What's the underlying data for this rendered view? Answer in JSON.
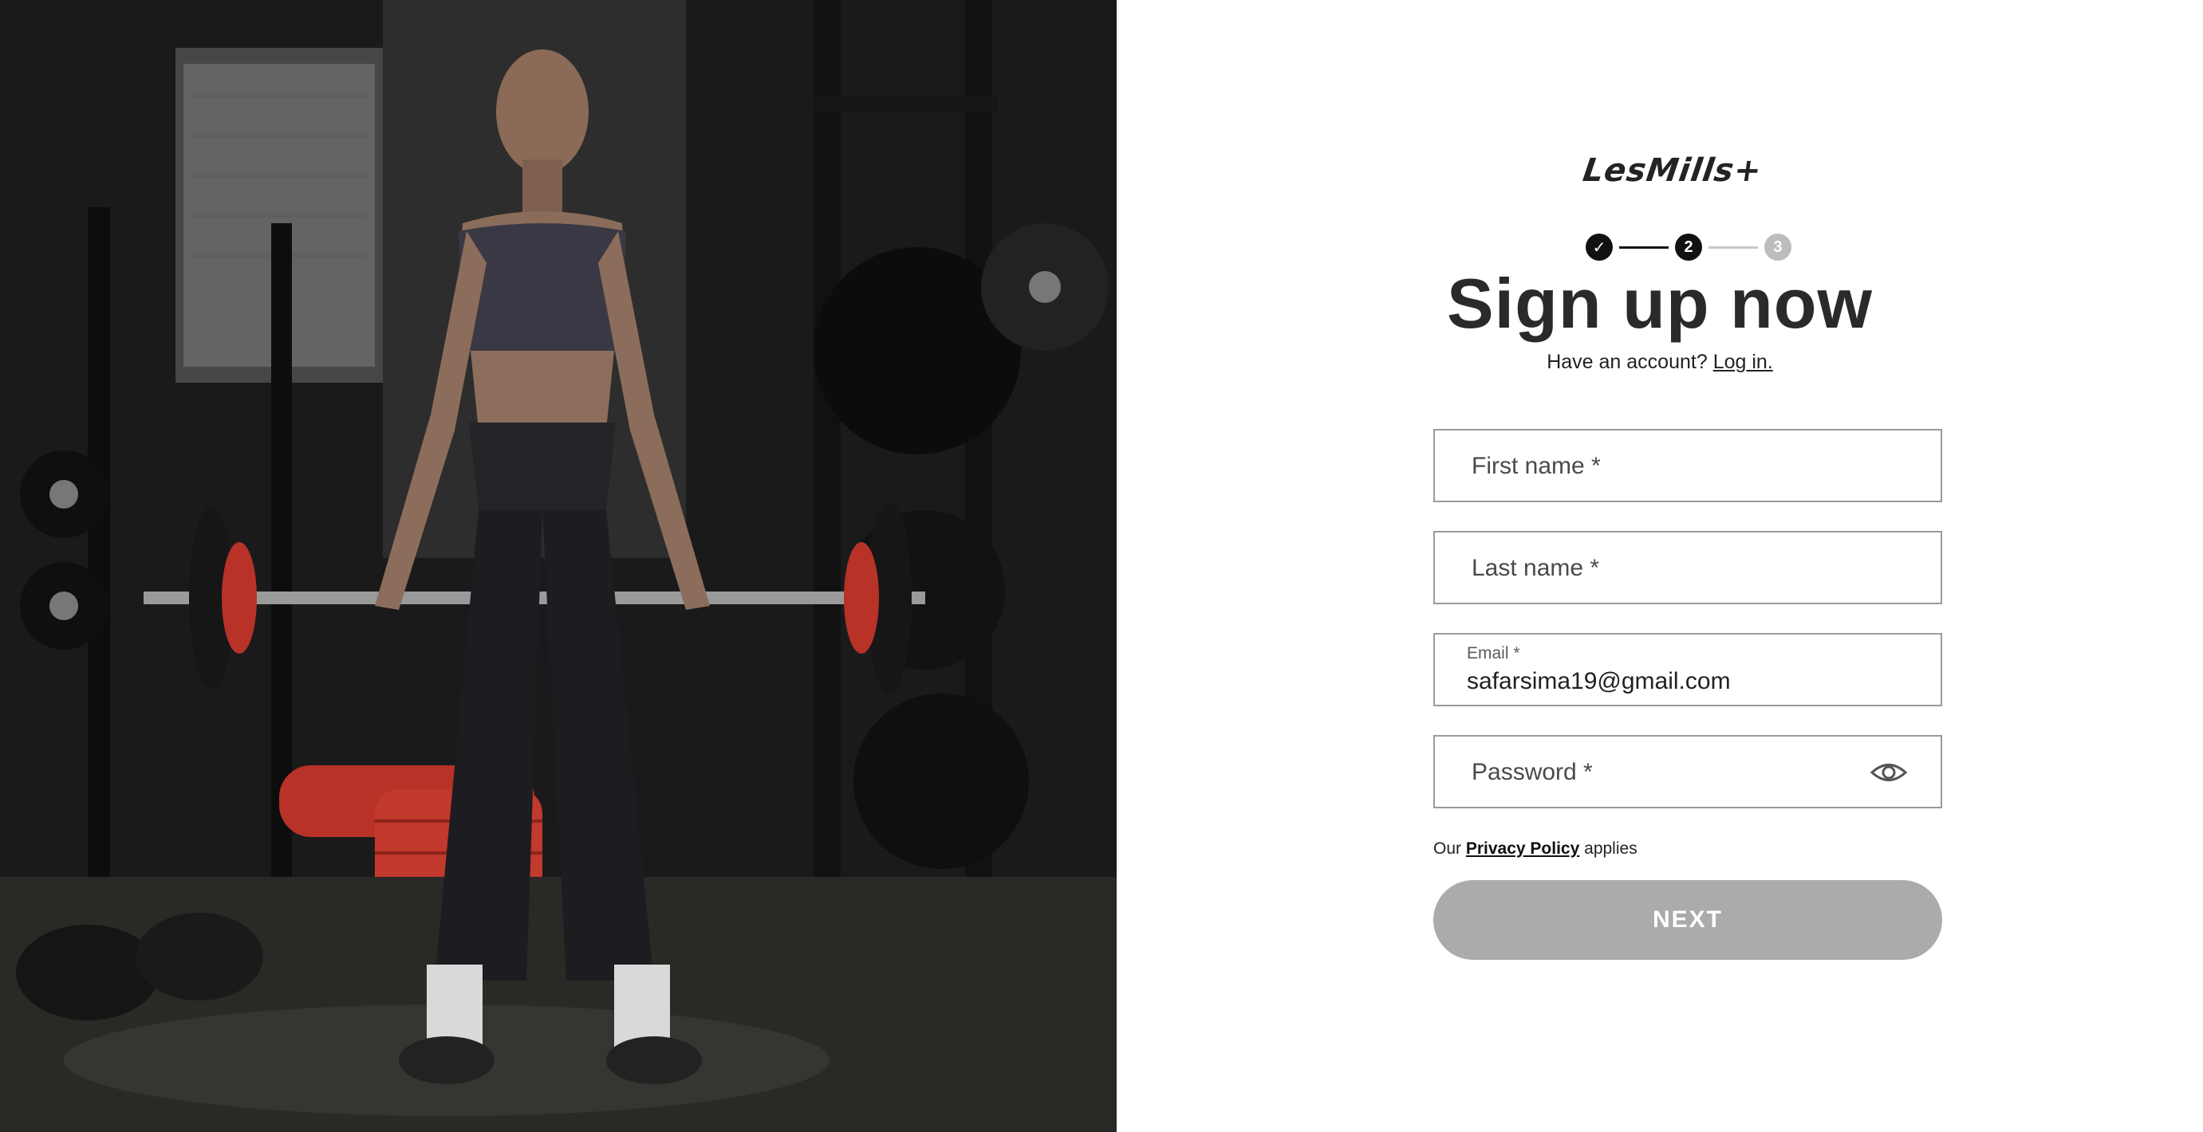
{
  "brand": {
    "logo_text": "LesMills+"
  },
  "stepper": {
    "steps": [
      {
        "label": "✓",
        "state": "done"
      },
      {
        "label": "2",
        "state": "active"
      },
      {
        "label": "3",
        "state": "upcoming"
      }
    ]
  },
  "heading": {
    "title": "Sign up now",
    "have_account": "Have an account?",
    "login_link": "Log in."
  },
  "form": {
    "first_name": {
      "placeholder": "First name *",
      "value": ""
    },
    "last_name": {
      "placeholder": "Last name *",
      "value": ""
    },
    "email": {
      "label": "Email *",
      "value": "safarsima19@gmail.com"
    },
    "password": {
      "placeholder": "Password *",
      "value": ""
    },
    "privacy_prefix": "Our",
    "privacy_link": "Privacy Policy",
    "privacy_suffix": "applies",
    "next_label": "NEXT"
  },
  "colors": {
    "button_disabled": "#ababab",
    "step_done": "#111111",
    "step_upcoming": "#bdbdbd",
    "field_border": "#9a9a9a"
  }
}
